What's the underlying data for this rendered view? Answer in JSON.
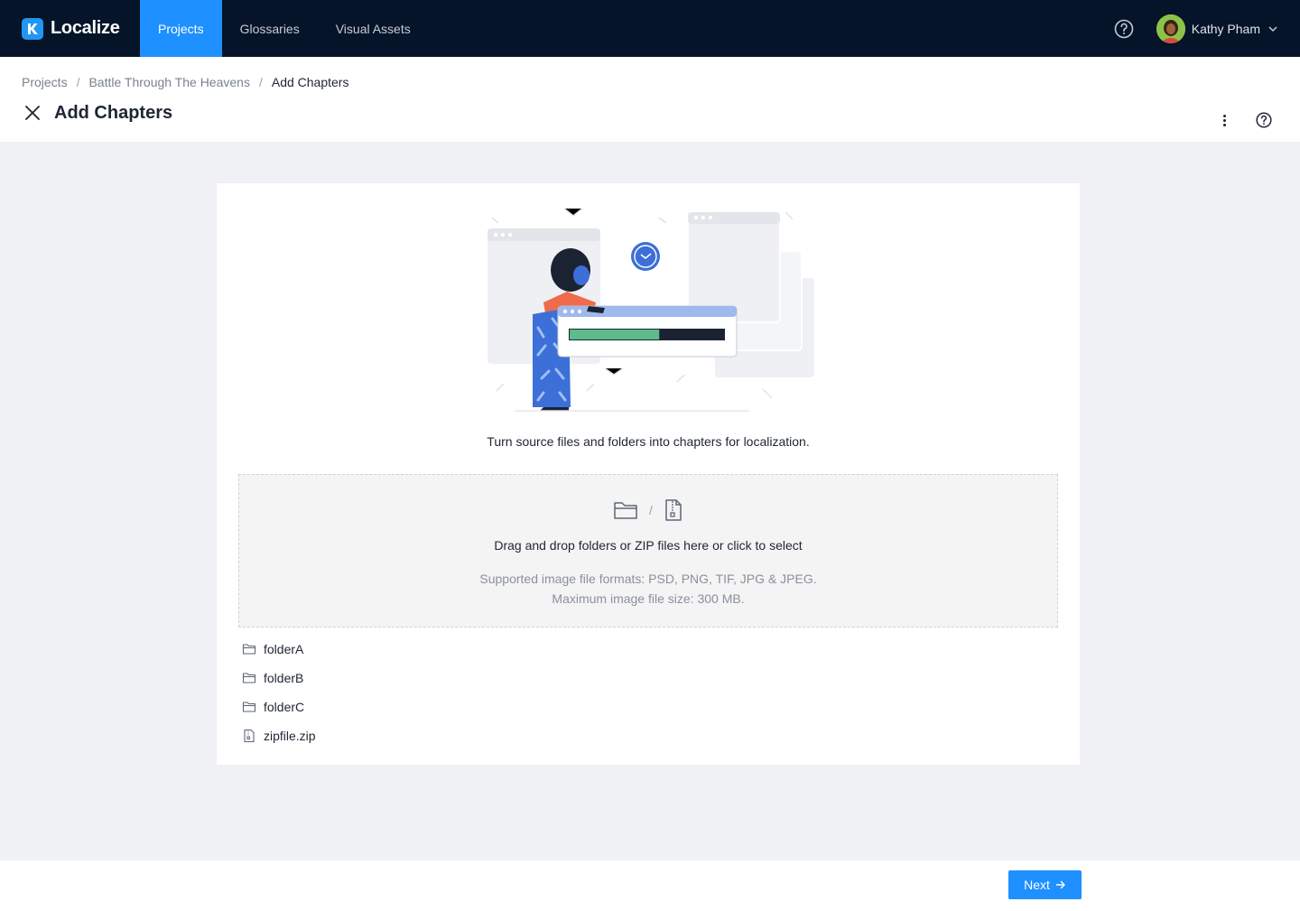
{
  "app": {
    "name": "Localize",
    "logo_letter": "K",
    "brand_color": "#2196f3"
  },
  "nav": {
    "items": [
      {
        "label": "Projects",
        "active": true
      },
      {
        "label": "Glossaries",
        "active": false
      },
      {
        "label": "Visual Assets",
        "active": false
      }
    ]
  },
  "user": {
    "name": "Kathy Pham"
  },
  "breadcrumb": {
    "items": [
      "Projects",
      "Battle Through The Heavens",
      "Add Chapters"
    ],
    "separator": "/"
  },
  "page": {
    "title": "Add Chapters"
  },
  "card": {
    "intro": "Turn source files and folders into chapters for localization.",
    "progress": 0.58,
    "dropzone": {
      "separator": "/",
      "main_text": "Drag and drop folders or ZIP files here or click to select",
      "formats_text": "Supported image file formats: PSD, PNG, TIF, JPG & JPEG.",
      "size_text": "Maximum image file size: 300 MB."
    },
    "files": [
      {
        "name": "folderA",
        "type": "folder"
      },
      {
        "name": "folderB",
        "type": "folder"
      },
      {
        "name": "folderC",
        "type": "folder"
      },
      {
        "name": "zipfile.zip",
        "type": "zip"
      }
    ]
  },
  "footer": {
    "next_label": "Next",
    "accent": "#1e90ff"
  },
  "icons": {
    "help": "help-circle-icon",
    "close": "close-icon",
    "kebab": "more-vertical-icon",
    "chevron": "chevron-down-icon",
    "folder": "folder-icon",
    "zip": "zip-file-icon",
    "arrow": "arrow-right-icon"
  }
}
